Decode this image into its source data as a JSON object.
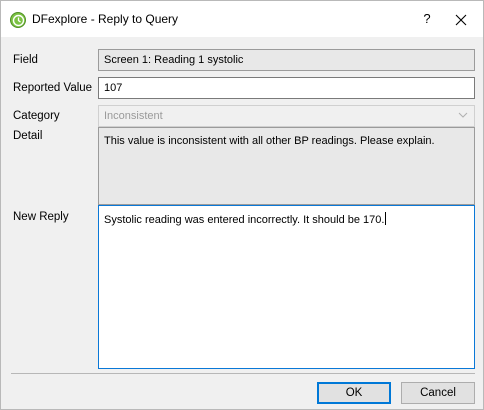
{
  "window": {
    "title": "DFexplore - Reply to Query",
    "help_label": "?"
  },
  "form": {
    "field_label": "Field",
    "field_value": "Screen 1: Reading 1 systolic",
    "reported_label": "Reported Value",
    "reported_value": "107",
    "category_label": "Category",
    "category_value": "Inconsistent",
    "detail_label": "Detail",
    "detail_value": "This value is inconsistent with all other BP readings. Please explain.",
    "reply_label": "New Reply",
    "reply_value": "Systolic reading was entered incorrectly. It should be 170."
  },
  "buttons": {
    "ok_label": "OK",
    "cancel_label": "Cancel"
  },
  "colors": {
    "focus_border": "#0a78d7",
    "app_icon": "#7cc243"
  }
}
